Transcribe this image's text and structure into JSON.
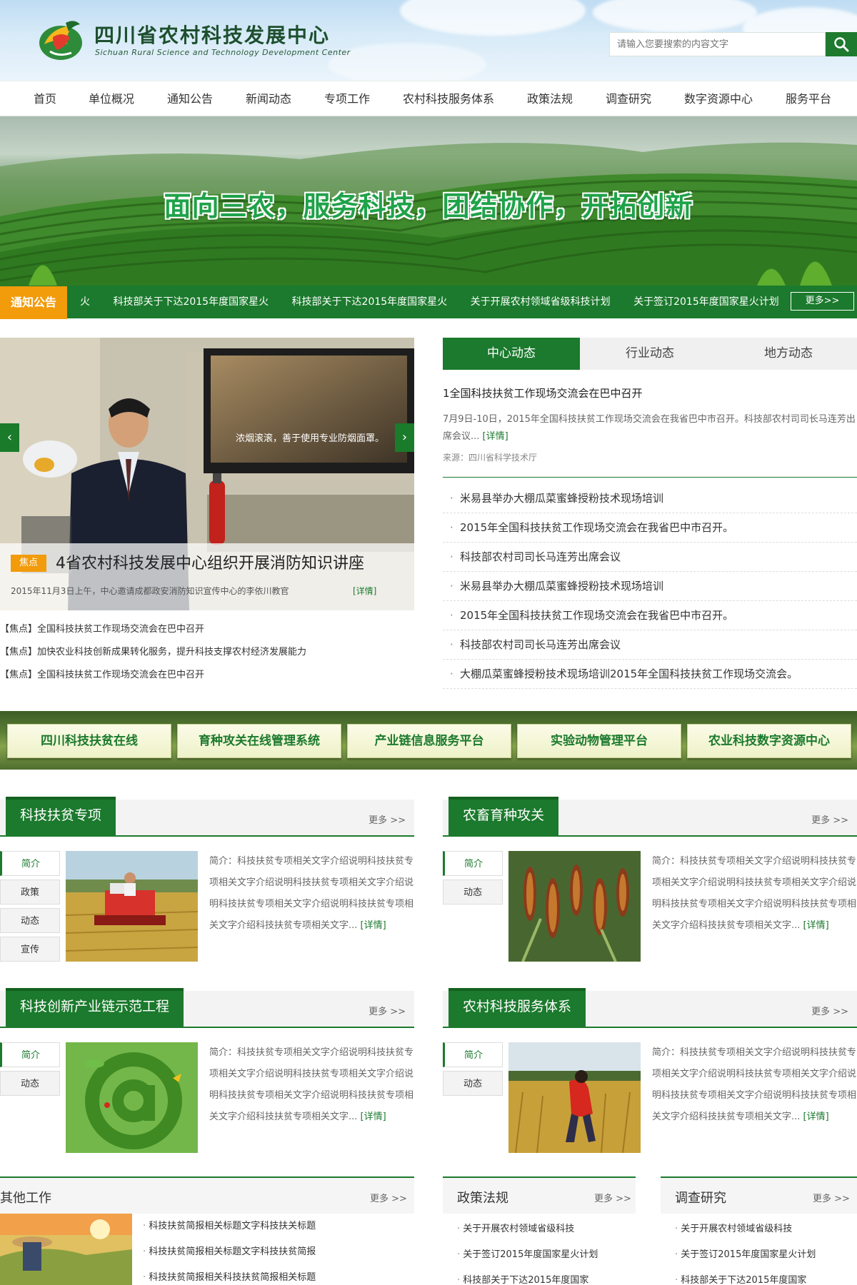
{
  "header": {
    "title": "四川省农村科技发展中心",
    "subtitle": "Sichuan Rural Science and Technology Development Center",
    "search_placeholder": "请输入您要搜索的内容文字"
  },
  "nav": [
    "首页",
    "单位概况",
    "通知公告",
    "新闻动态",
    "专项工作",
    "农村科技服务体系",
    "政策法规",
    "调查研究",
    "数字资源中心",
    "服务平台"
  ],
  "banner": {
    "slogan": "面向三农，服务科技，团结协作，开拓创新"
  },
  "notice": {
    "tag": "通知公告",
    "items": [
      "火",
      "科技部关于下达2015年度国家星火",
      "科技部关于下达2015年度国家星火",
      "关于开展农村领域省级科技计划",
      "关于签订2015年度国家星火计划"
    ],
    "more": "更多>>"
  },
  "focus": {
    "badge": "焦点",
    "title": "4省农村科技发展中心组织开展消防知识讲座",
    "summary": "2015年11月3日上午，中心邀请成都政安消防知识宣传中心的李依川教官",
    "detail": "[详情]",
    "photo_text": "浓烟滚滚，善于使用专业防烟面罩。",
    "list": [
      "【焦点】全国科技扶贫工作现场交流会在巴中召开",
      "【焦点】加快农业科技创新成果转化服务，提升科技支撑农村经济发展能力",
      "【焦点】全国科技扶贫工作现场交流会在巴中召开"
    ]
  },
  "news": {
    "tabs": [
      "中心动态",
      "行业动态",
      "地方动态"
    ],
    "headline": "1全国科技扶贫工作现场交流会在巴中召开",
    "headline_summary": "7月9日-10日，2015年全国科技扶贫工作现场交流会在我省巴中市召开。科技部农村司司长马连芳出席会议...",
    "headline_detail": "[详情]",
    "source": "来源：四川省科学技术厅",
    "items": [
      "米易县举办大棚瓜菜蜜蜂授粉技术现场培训",
      "2015年全国科技扶贫工作现场交流会在我省巴中市召开。",
      "科技部农村司司长马连芳出席会议",
      "米易县举办大棚瓜菜蜜蜂授粉技术现场培训",
      "2015年全国科技扶贫工作现场交流会在我省巴中市召开。",
      "科技部农村司司长马连芳出席会议",
      "大棚瓜菜蜜蜂授粉技术现场培训2015年全国科技扶贫工作现场交流会。"
    ]
  },
  "platforms": [
    "四川科技扶贫在线",
    "育种攻关在线管理系统",
    "产业链信息服务平台",
    "实验动物管理平台",
    "农业科技数字资源中心"
  ],
  "sections": [
    {
      "title": "科技扶贫专项",
      "more": "更多 >>",
      "tabs": [
        "简介",
        "政策",
        "动态",
        "宣传"
      ],
      "text": "简介：科技扶贫专项相关文字介绍说明科技扶贫专项相关文字介绍说明科技扶贫专项相关文字介绍说明科技扶贫专项相关文字介绍说明科技扶贫专项相关文字介绍科技扶贫专项相关文字...",
      "detail": "[详情]"
    },
    {
      "title": "农畜育种攻关",
      "more": "更多 >>",
      "tabs": [
        "简介",
        "动态"
      ],
      "text": "简介：科技扶贫专项相关文字介绍说明科技扶贫专项相关文字介绍说明科技扶贫专项相关文字介绍说明科技扶贫专项相关文字介绍说明科技扶贫专项相关文字介绍科技扶贫专项相关文字...",
      "detail": "[详情]"
    },
    {
      "title": "科技创新产业链示范工程",
      "more": "更多 >>",
      "tabs": [
        "简介",
        "动态"
      ],
      "text": "简介：科技扶贫专项相关文字介绍说明科技扶贫专项相关文字介绍说明科技扶贫专项相关文字介绍说明科技扶贫专项相关文字介绍说明科技扶贫专项相关文字介绍科技扶贫专项相关文字...",
      "detail": "[详情]"
    },
    {
      "title": "农村科技服务体系",
      "more": "更多 >>",
      "tabs": [
        "简介",
        "动态"
      ],
      "text": "简介：科技扶贫专项相关文字介绍说明科技扶贫专项相关文字介绍说明科技扶贫专项相关文字介绍说明科技扶贫专项相关文字介绍说明科技扶贫专项相关文字介绍科技扶贫专项相关文字...",
      "detail": "[详情]"
    }
  ],
  "bottom": {
    "other": {
      "title": "其他工作",
      "more": "更多 >>",
      "items": [
        "科技扶贫简报相关标题文字科技扶关标题",
        "科技扶贫简报相关标题文字科技扶贫简报",
        "科技扶贫简报相关科技扶贫简报相关标题"
      ]
    },
    "policy": {
      "title": "政策法规",
      "more": "更多 >>",
      "items": [
        "关于开展农村领域省级科技",
        "关于签订2015年度国家星火计划",
        "科技部关于下达2015年度国家"
      ]
    },
    "research": {
      "title": "调查研究",
      "more": "更多 >>",
      "items": [
        "关于开展农村领域省级科技",
        "关于签订2015年度国家星火计划",
        "科技部关于下达2015年度国家"
      ]
    }
  }
}
